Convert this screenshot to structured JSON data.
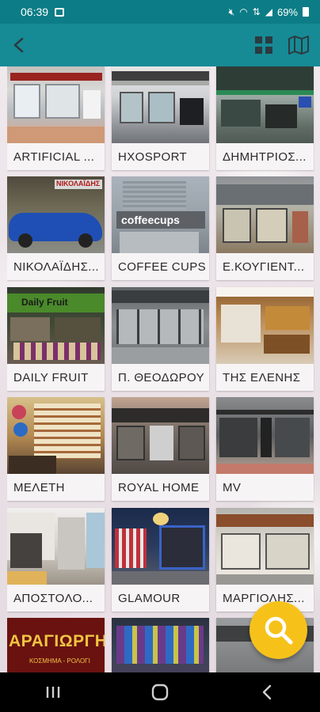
{
  "status_bar": {
    "time": "06:39",
    "battery": "69%",
    "icons": [
      "image-icon",
      "mute-icon",
      "wifi-icon",
      "data-icon",
      "signal-icon",
      "battery-icon"
    ]
  },
  "app_bar": {
    "back_icon": "arrow-back-icon",
    "grid_icon": "grid-view-icon",
    "map_icon": "map-icon",
    "color": "#168b96"
  },
  "stores": [
    {
      "name": "ARTIFICIAL ..."
    },
    {
      "name": "HXOSPORT"
    },
    {
      "name": "ΔΗΜΗΤΡΙΟΣ..."
    },
    {
      "name": "ΝΙΚΟΛΑΪΔΗΣ..."
    },
    {
      "name": "COFFEE CUPS"
    },
    {
      "name": "Ε.ΚΟΥΓΙΕΝΤ..."
    },
    {
      "name": "DAILY FRUIT"
    },
    {
      "name": "Π. ΘΕΟΔΩΡΟΥ"
    },
    {
      "name": "ΤΗΣ ΕΛΕΝΗΣ"
    },
    {
      "name": "ΜΕΛΕΤΗ"
    },
    {
      "name": "ROYAL HOME"
    },
    {
      "name": "MV"
    },
    {
      "name": "ΑΠΟΣΤΟΛΟ..."
    },
    {
      "name": "GLAMOUR"
    },
    {
      "name": "ΜΑΡΓΙΟΛΗΣ..."
    },
    {
      "name": ""
    },
    {
      "name": ""
    },
    {
      "name": ""
    }
  ],
  "photo_signs": {
    "nikolaidis": "ΝΙΚΟΛΑΪΔΗΣ",
    "coffee": "coffeecups",
    "daily": "Daily Fruit",
    "karagiorgi": "ΑΡΑΓΙΩΡΓΗ",
    "karagiorgi_sub": "ΚΟΣΜΗΜΑ - ΡΟΛΟΓΙ"
  },
  "fab": {
    "icon": "search-icon",
    "color": "#f6c21a"
  },
  "nav_bar": {
    "icons": [
      "recent-apps-icon",
      "home-icon",
      "back-icon"
    ]
  }
}
